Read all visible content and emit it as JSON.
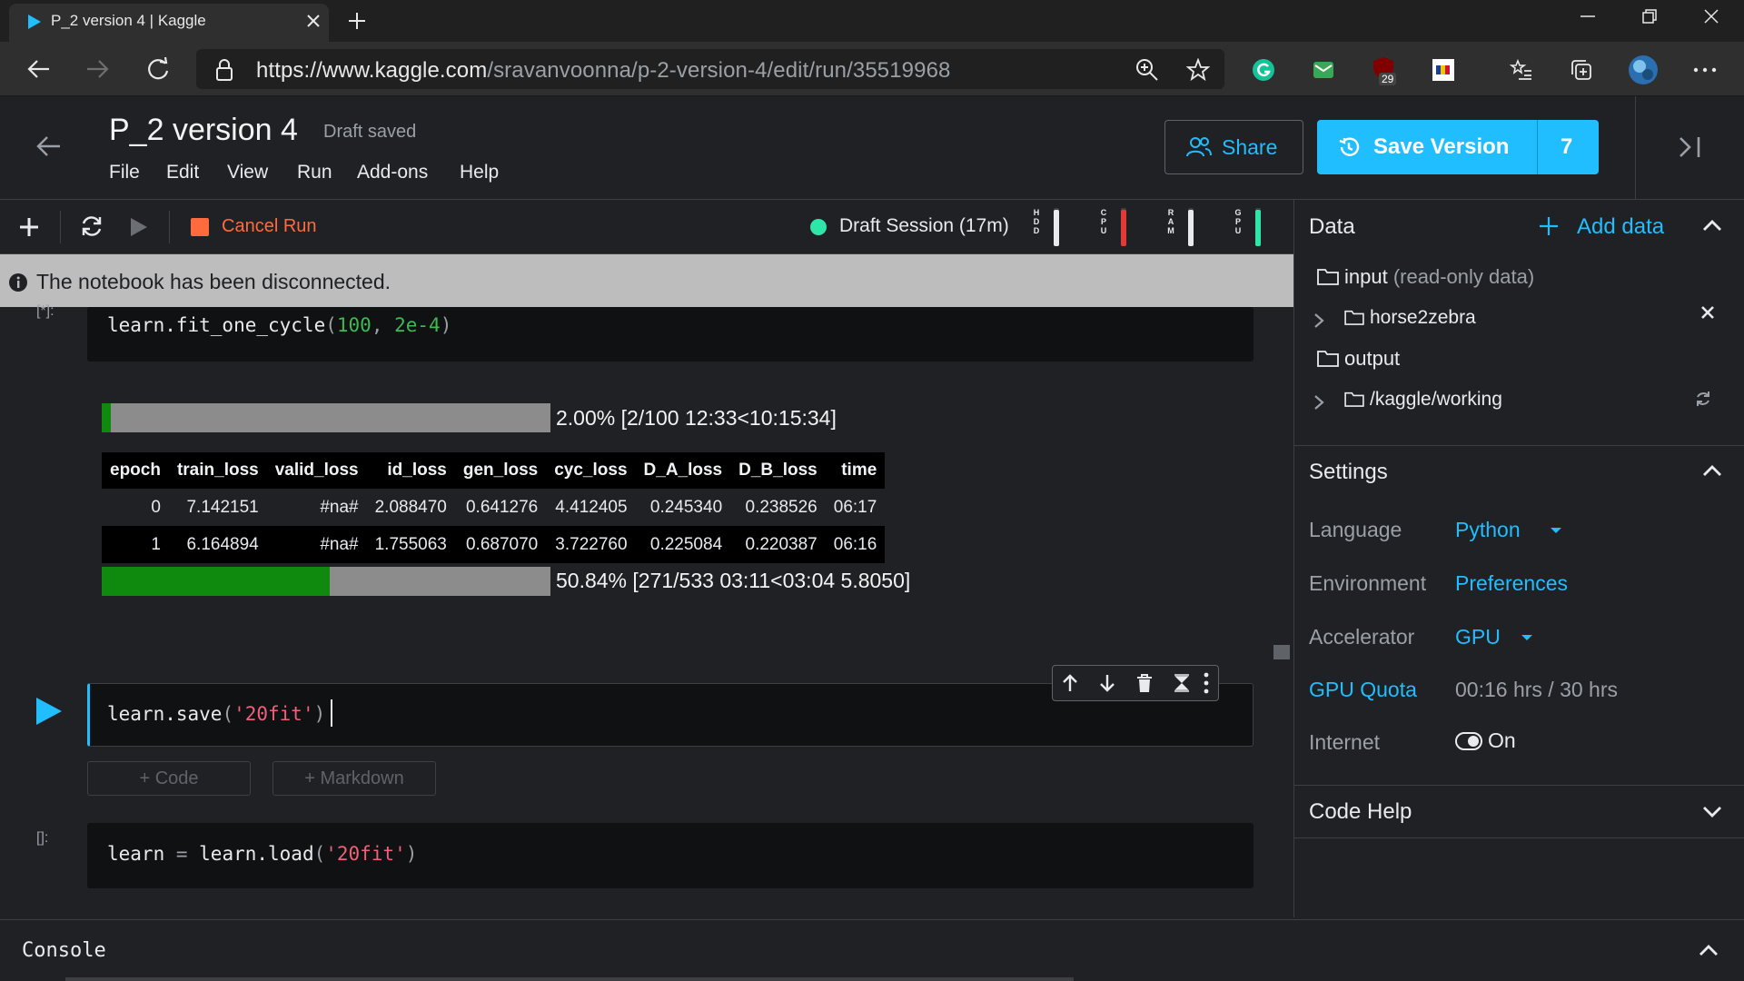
{
  "browser": {
    "tab_title": "P_2 version 4 | Kaggle",
    "url_main": "https://www.kaggle.com",
    "url_path": "/sravanvoonna/p-2-version-4/edit/run/35519968",
    "extension_badge": "29"
  },
  "header": {
    "title": "P_2 version 4",
    "status": "Draft saved",
    "menu": [
      "File",
      "Edit",
      "View",
      "Run",
      "Add-ons",
      "Help"
    ],
    "share_label": "Share",
    "save_label": "Save Version",
    "version_count": "7"
  },
  "toolbar": {
    "cancel_label": "Cancel Run",
    "session_label": "Draft Session (17m)",
    "meters": [
      {
        "label": "HDD",
        "level": 0.95,
        "color": "#e8eaed"
      },
      {
        "label": "CPU",
        "level": 0.95,
        "color": "#e53935"
      },
      {
        "label": "RAM",
        "level": 0.95,
        "color": "#e8eaed"
      },
      {
        "label": "GPU",
        "level": 0.95,
        "color": "#2ee6a8"
      }
    ]
  },
  "banner": {
    "text": "The notebook has been disconnected."
  },
  "cells": {
    "cell1": {
      "prompt": "[*]:",
      "code": {
        "fn": "learn.fit_one_cycle",
        "open": "(",
        "arg1": "100",
        "comma": ", ",
        "arg2": "2e-4",
        "close": ")"
      },
      "progress1": {
        "fraction": 0.02,
        "text": "2.00% [2/100 12:33<10:15:34]"
      },
      "table": {
        "columns": [
          "epoch",
          "train_loss",
          "valid_loss",
          "id_loss",
          "gen_loss",
          "cyc_loss",
          "D_A_loss",
          "D_B_loss",
          "time"
        ],
        "rows": [
          [
            "0",
            "7.142151",
            "#na#",
            "2.088470",
            "0.641276",
            "4.412405",
            "0.245340",
            "0.238526",
            "06:17"
          ],
          [
            "1",
            "6.164894",
            "#na#",
            "1.755063",
            "0.687070",
            "3.722760",
            "0.225084",
            "0.220387",
            "06:16"
          ]
        ]
      },
      "progress2": {
        "fraction": 0.5084,
        "text": "50.84% [271/533 03:11<03:04 5.8050]"
      }
    },
    "cell2": {
      "code": {
        "fn": "learn.save",
        "open": "(",
        "arg": "'20fit'",
        "close": ")"
      }
    },
    "add_code": "+ Code",
    "add_markdown": "+ Markdown",
    "cell3": {
      "prompt": "[]:",
      "code": {
        "lhs": "learn ",
        "eq": "=",
        "fn": " learn.load",
        "open": "(",
        "arg": "'20fit'",
        "close": ")"
      }
    }
  },
  "right_panel": {
    "data_title": "Data",
    "add_data": "Add data",
    "input_label": "input",
    "input_note": "(read-only data)",
    "dataset": "horse2zebra",
    "output_label": "output",
    "working_dir": "/kaggle/working",
    "settings_title": "Settings",
    "language_label": "Language",
    "language_value": "Python",
    "environment_label": "Environment",
    "environment_value": "Preferences",
    "accelerator_label": "Accelerator",
    "accelerator_value": "GPU",
    "quota_label": "GPU Quota",
    "quota_value": "00:16 hrs / 30 hrs",
    "internet_label": "Internet",
    "internet_value": "On",
    "code_help_title": "Code Help"
  },
  "console": {
    "label": "Console"
  },
  "colors": {
    "accent": "#20beff",
    "progress_fill": "#0f8a0f",
    "cancel": "#ff6b3d",
    "session_dot": "#2ee6a8"
  }
}
